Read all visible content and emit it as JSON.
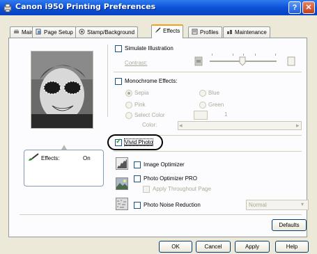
{
  "window": {
    "title": "Canon i950 Printing Preferences",
    "help_glyph": "?",
    "close_glyph": "✕"
  },
  "tabs": [
    {
      "label": "Main",
      "icon": "printer-icon"
    },
    {
      "label": "Page Setup",
      "icon": "page-setup-icon"
    },
    {
      "label": "Stamp/Background",
      "icon": "stamp-icon"
    },
    {
      "label": "Effects",
      "icon": "effects-brush-icon",
      "active": true
    },
    {
      "label": "Profiles",
      "icon": "profiles-icon"
    },
    {
      "label": "Maintenance",
      "icon": "maintenance-icon"
    }
  ],
  "preview": {
    "effects_label": "Effects:",
    "effects_value": "On"
  },
  "simulate": {
    "label": "Simulate Illustration",
    "contrast_label": "Contrast:",
    "checked": false
  },
  "monochrome": {
    "label": "Monochrome Effects:",
    "checked": false,
    "options": {
      "sepia": "Sepia",
      "blue": "Blue",
      "pink": "Pink",
      "green": "Green",
      "select_color": "Select Color"
    },
    "color_label": "Color:",
    "color_value": "1"
  },
  "vivid_photo": {
    "label": "Vivid Photo",
    "checked": true
  },
  "image_optimizer": {
    "label": "Image Optimizer",
    "checked": false
  },
  "photo_optimizer": {
    "label": "Photo Optimizer PRO",
    "checked": false,
    "apply_label": "Apply Throughout Page"
  },
  "noise_reduction": {
    "label": "Photo Noise Reduction",
    "checked": false,
    "select_value": "Normal"
  },
  "buttons": {
    "defaults": "Defaults",
    "ok": "OK",
    "cancel": "Cancel",
    "apply": "Apply",
    "help": "Help"
  },
  "colors": {
    "titlebar": "#0a4fd6",
    "tab_accent": "#f5a01c",
    "dialog_bg": "#ece9d8"
  }
}
